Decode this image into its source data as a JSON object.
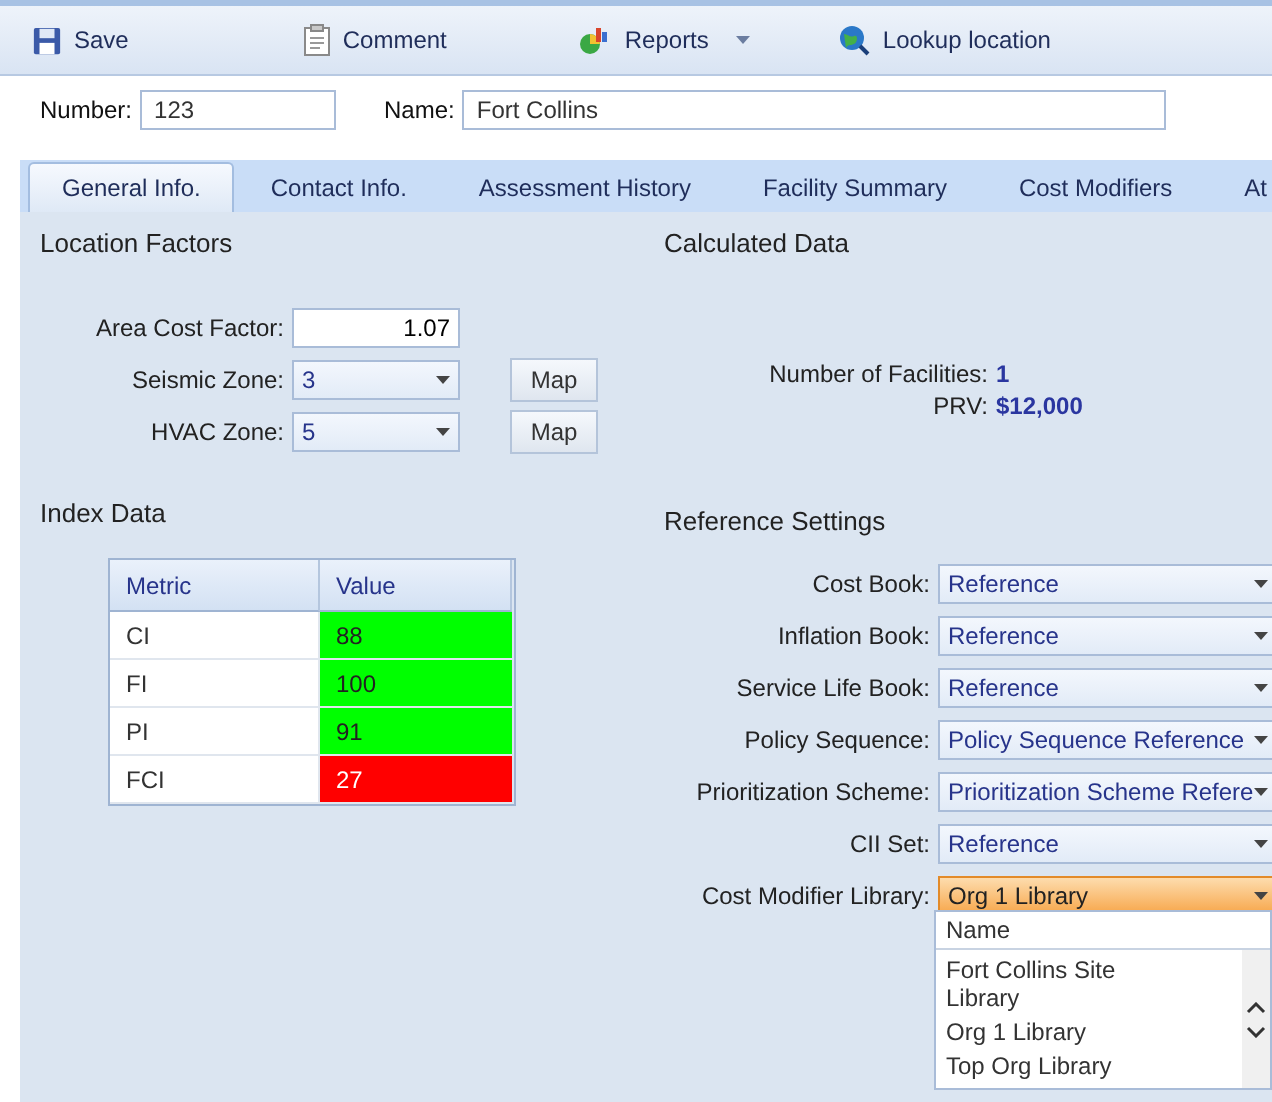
{
  "toolbar": [
    {
      "kind": "save",
      "label": "Save"
    },
    {
      "kind": "comment",
      "label": "Comment"
    },
    {
      "kind": "reports",
      "label": "Reports",
      "menu": true
    },
    {
      "kind": "lookup",
      "label": "Lookup location"
    }
  ],
  "header_fields": [
    {
      "label": "Number:",
      "value": "123",
      "kind": "short"
    },
    {
      "label": "Name:",
      "value": "Fort Collins",
      "kind": "long"
    }
  ],
  "tabs": [
    {
      "label": "General Info.",
      "selected": true
    },
    {
      "label": "Contact Info.",
      "selected": false
    },
    {
      "label": "Assessment History",
      "selected": false
    },
    {
      "label": "Facility Summary",
      "selected": false
    },
    {
      "label": "Cost Modifiers",
      "selected": false
    },
    {
      "label": "At",
      "selected": false
    }
  ],
  "location_factors": {
    "title": "Location Factors",
    "fields": [
      {
        "kind": "text",
        "label": "Area Cost Factor:",
        "value": "1.07"
      },
      {
        "kind": "select",
        "label": "Seismic Zone:",
        "value": "3",
        "button": "Map"
      },
      {
        "kind": "select",
        "label": "HVAC Zone:",
        "value": "5",
        "button": "Map"
      }
    ]
  },
  "calculated_data": {
    "title": "Calculated Data",
    "items": [
      {
        "label": "Number of Facilities:",
        "value": "1"
      },
      {
        "label": "PRV:",
        "value": "$12,000"
      }
    ]
  },
  "index_data": {
    "title": "Index Data",
    "columns": [
      "Metric",
      "Value"
    ],
    "rows": [
      {
        "metric": "CI",
        "value": "88",
        "color": "#00ff00"
      },
      {
        "metric": "FI",
        "value": "100",
        "color": "#00ff00"
      },
      {
        "metric": "PI",
        "value": "91",
        "color": "#00ff00"
      },
      {
        "metric": "FCI",
        "value": "27",
        "color": "#ff0000"
      }
    ]
  },
  "reference_settings": {
    "title": "Reference Settings",
    "fields": [
      {
        "label": "Cost Book:",
        "value": "Reference",
        "focused": false
      },
      {
        "label": "Inflation Book:",
        "value": "Reference",
        "focused": false
      },
      {
        "label": "Service Life Book:",
        "value": "Reference",
        "focused": false
      },
      {
        "label": "Policy Sequence:",
        "value": "Policy Sequence Reference",
        "focused": false
      },
      {
        "label": "Prioritization Scheme:",
        "value": "Prioritization Scheme Refere",
        "focused": false
      },
      {
        "label": "CII Set:",
        "value": "Reference",
        "focused": false
      },
      {
        "label": "Cost Modifier Library:",
        "value": "Org 1 Library",
        "focused": true
      }
    ]
  },
  "dropdown": {
    "header": "Name",
    "items": [
      {
        "label": "Fort Collins Site Library",
        "selected": false
      },
      {
        "label": "Org 1 Library",
        "selected": false
      },
      {
        "label": "Top Org Library",
        "selected": false
      }
    ]
  }
}
